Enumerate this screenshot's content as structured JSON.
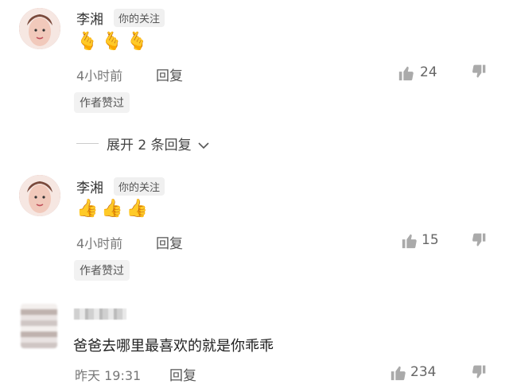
{
  "comments": [
    {
      "name": "李湘",
      "tag": "你的关注",
      "emoji": "🫰🫰🫰",
      "time": "4小时前",
      "reply": "回复",
      "likes": "24",
      "author_liked": "作者赞过"
    },
    {
      "name": "李湘",
      "tag": "你的关注",
      "emoji": "👍👍👍",
      "time": "4小时前",
      "reply": "回复",
      "likes": "15",
      "author_liked": "作者赞过"
    },
    {
      "text": "爸爸去哪里最喜欢的就是你乖乖",
      "time": "昨天 19:31",
      "reply": "回复",
      "likes": "234"
    }
  ],
  "expand": {
    "label": "展开 2 条回复"
  }
}
